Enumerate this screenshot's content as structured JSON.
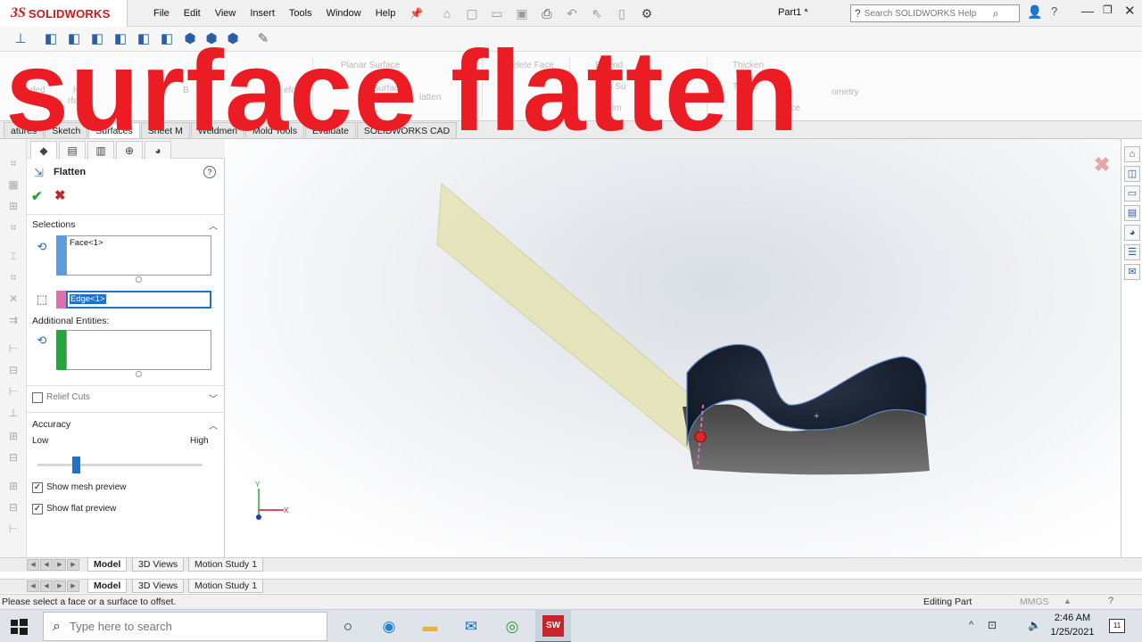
{
  "app": {
    "logo_mark": "3S",
    "logo_text": "SOLIDWORKS",
    "document_title": "Part1 *"
  },
  "menu": {
    "items": [
      "File",
      "Edit",
      "View",
      "Insert",
      "Tools",
      "Window",
      "Help"
    ]
  },
  "search": {
    "placeholder": "Search SOLIDWORKS Help"
  },
  "ribbon": {
    "labels": [
      {
        "text": "Planar Surface"
      },
      {
        "text": "Delete Face"
      },
      {
        "text": "Extend"
      },
      {
        "text": "Trim Su"
      },
      {
        "text": "Untrim"
      },
      {
        "text": "face"
      },
      {
        "text": "Thicken"
      },
      {
        "text": "Thicke"
      },
      {
        "text": "face"
      },
      {
        "text": "ometry"
      },
      {
        "text": "Surface"
      },
      {
        "text": "lved"
      },
      {
        "text": "rface"
      },
      {
        "text": "ept"
      },
      {
        "text": "face"
      },
      {
        "text": "ded"
      },
      {
        "text": "Surface"
      },
      {
        "text": "latten"
      },
      {
        "text": "B"
      },
      {
        "text": "eform"
      }
    ]
  },
  "command_tabs": [
    {
      "label": "atures"
    },
    {
      "label": "Sketch"
    },
    {
      "label": "Surfaces"
    },
    {
      "label": "Sheet M"
    },
    {
      "label": "Weldmen"
    },
    {
      "label": "Mold Tools"
    },
    {
      "label": "Evaluate"
    },
    {
      "label": "SOLIDWORKS CAD"
    }
  ],
  "property_manager": {
    "title": "Flatten",
    "help": "?",
    "ok": "✔",
    "cancel": "✖",
    "selections": {
      "title": "Selections",
      "face_value": "Face<1>",
      "edge_value": "Edge<1>",
      "additional_label": "Additional Entities:",
      "additional_value": ""
    },
    "relief_cuts": {
      "label": "Relief Cuts",
      "checked": false
    },
    "accuracy": {
      "title": "Accuracy",
      "low_label": "Low",
      "high_label": "High",
      "value_fraction": 0.22
    },
    "options": [
      {
        "label": "Show mesh preview",
        "checked": true
      },
      {
        "label": "Show flat preview",
        "checked": true
      }
    ]
  },
  "triad": {
    "x": "X",
    "y": "Y"
  },
  "model_tabs": [
    {
      "label": "Model",
      "active": true
    },
    {
      "label": "3D Views",
      "active": false
    },
    {
      "label": "Motion Study 1",
      "active": false
    }
  ],
  "status": {
    "message": "Please select a face or a surface to offset.",
    "mode": "Editing Part",
    "units": "MMGS"
  },
  "taskbar": {
    "search_placeholder": "Type here to search",
    "sw_badge": "SW",
    "time": "2:46 AM",
    "date": "1/25/2021",
    "notifications": "11"
  },
  "overlay": {
    "caption": "surface flatten",
    "color": "#ec1c24"
  },
  "icons": {
    "title_bar": [
      "pin-icon",
      "home-icon",
      "new-doc-icon",
      "open-icon",
      "save-icon",
      "print-icon",
      "undo-icon",
      "select-icon",
      "rebuild-icon",
      "options-icon",
      "search-icon",
      "user-icon",
      "help-icon"
    ],
    "taskpane": [
      "home-icon",
      "parts-icon",
      "folder-icon",
      "view-palette-icon",
      "appearance-icon",
      "custom-properties-icon",
      "forum-icon"
    ]
  },
  "colors": {
    "accent_blue": "#1e72c8",
    "selection_face": "#5b9be0",
    "selection_edge": "#e06fb0",
    "selection_extra": "#22a83a",
    "flat_preview": "#e6e4b8",
    "part_body": "#1b2535"
  }
}
